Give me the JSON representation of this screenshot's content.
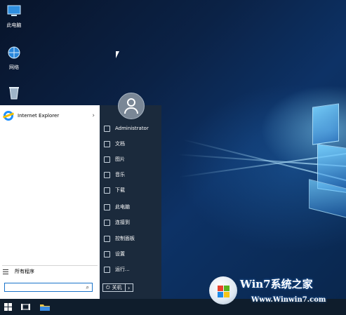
{
  "desktop": {
    "icons": [
      {
        "label": "此电脑",
        "icon": "computer-icon"
      },
      {
        "label": "网络",
        "icon": "network-icon"
      },
      {
        "label": "回收站",
        "icon": "recycle-bin-icon"
      }
    ]
  },
  "start_menu": {
    "pinned": [
      {
        "label": "Internet Explorer",
        "icon": "internet-explorer-icon"
      }
    ],
    "all_programs_label": "所有程序",
    "search": {
      "value": "",
      "placeholder": ""
    },
    "user": {
      "name": "Administrator",
      "icon": "user-avatar-icon"
    },
    "right_items": [
      {
        "label": "文档",
        "icon": "document-icon"
      },
      {
        "label": "图片",
        "icon": "picture-icon"
      },
      {
        "label": "音乐",
        "icon": "music-icon"
      },
      {
        "label": "下载",
        "icon": "download-icon"
      },
      {
        "label": "此电脑",
        "icon": "computer-icon"
      },
      {
        "label": "连接到",
        "icon": "connect-icon"
      },
      {
        "label": "控制面板",
        "icon": "control-panel-icon"
      },
      {
        "label": "设置",
        "icon": "gear-icon"
      },
      {
        "label": "运行...",
        "icon": "run-icon"
      }
    ],
    "power": {
      "label": "关机",
      "icon": "power-icon",
      "arrow_icon": "chevron-right-icon"
    }
  },
  "taskbar": {
    "items": [
      {
        "icon": "windows-start-icon"
      },
      {
        "icon": "task-view-icon"
      },
      {
        "icon": "file-explorer-icon"
      }
    ]
  },
  "watermark": {
    "title": "Win7系统之家",
    "url": "Www.Winwin7.com"
  },
  "colors": {
    "accent": "#1a73c9",
    "menu_dark": "#1b2a3c",
    "taskbar": "#0f1d2c"
  }
}
